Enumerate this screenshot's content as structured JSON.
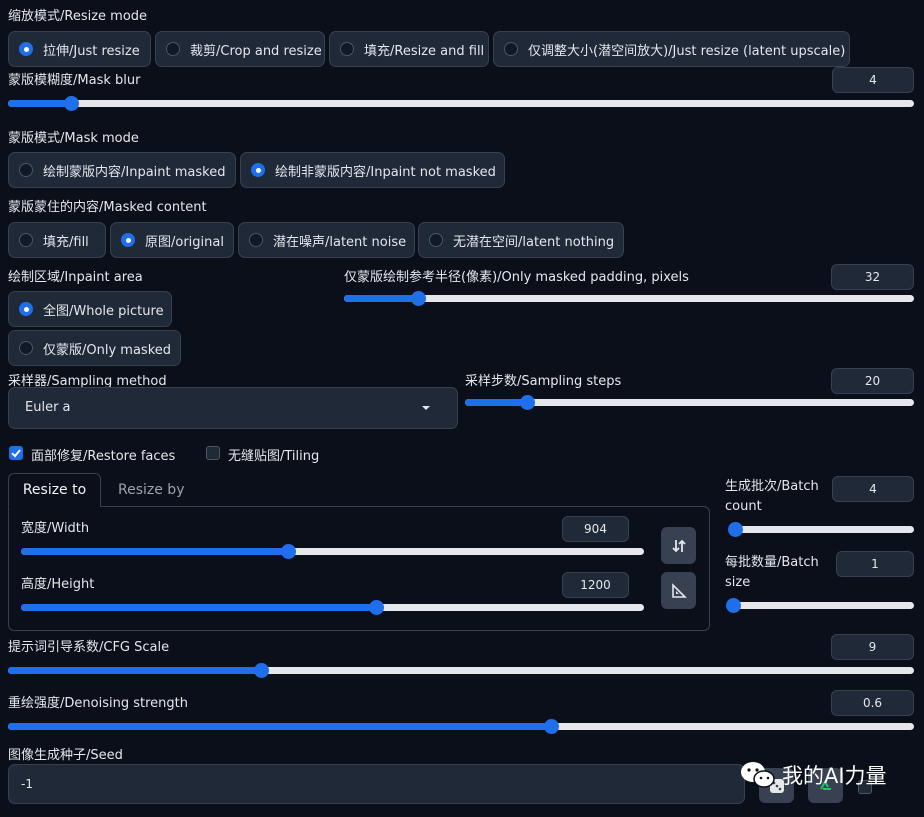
{
  "resize_mode": {
    "label": "缩放模式/Resize mode",
    "options": [
      "拉伸/Just resize",
      "裁剪/Crop and resize",
      "填充/Resize and fill",
      "仅调整大小(潜空间放大)/Just resize (latent upscale)"
    ],
    "selected": 0
  },
  "mask_blur": {
    "label": "蒙版模糊度/Mask blur",
    "value": "4",
    "fraction": 0.07
  },
  "mask_mode": {
    "label": "蒙版模式/Mask mode",
    "options": [
      "绘制蒙版内容/Inpaint masked",
      "绘制非蒙版内容/Inpaint not masked"
    ],
    "selected": 1
  },
  "masked_content": {
    "label": "蒙版蒙住的内容/Masked content",
    "options": [
      "填充/fill",
      "原图/original",
      "潜在噪声/latent noise",
      "无潜在空间/latent nothing"
    ],
    "selected": 1
  },
  "inpaint_area": {
    "label": "绘制区域/Inpaint area",
    "options": [
      "全图/Whole picture",
      "仅蒙版/Only masked"
    ],
    "selected": 0
  },
  "padding": {
    "label": "仅蒙版绘制参考半径(像素)/Only masked padding, pixels",
    "value": "32",
    "fraction": 0.13
  },
  "sampler": {
    "label": "采样器/Sampling method",
    "value": "Euler a"
  },
  "steps": {
    "label": "采样步数/Sampling steps",
    "value": "20",
    "fraction": 0.14
  },
  "restore_faces": {
    "label": "面部修复/Restore faces",
    "checked": true
  },
  "tiling": {
    "label": "无缝贴图/Tiling",
    "checked": false
  },
  "resize_tabs": [
    "Resize to",
    "Resize by"
  ],
  "width": {
    "label": "宽度/Width",
    "value": "904",
    "fraction": 0.43
  },
  "height": {
    "label": "高度/Height",
    "value": "1200",
    "fraction": 0.57
  },
  "batch_count": {
    "label_1": "生成批次/Batch",
    "label_2": "count",
    "value": "4",
    "fraction": 0.02
  },
  "batch_size": {
    "label_1": "每批数量/Batch",
    "label_2": "size",
    "value": "1",
    "fraction": 0.0
  },
  "cfg": {
    "label": "提示词引导系数/CFG Scale",
    "value": "9",
    "fraction": 0.28
  },
  "denoise": {
    "label": "重绘强度/Denoising strength",
    "value": "0.6",
    "fraction": 0.6
  },
  "seed": {
    "label": "图像生成种子/Seed",
    "value": "-1"
  },
  "watermark": "我的AI力量",
  "colors": {
    "accent": "#1f6feb",
    "background": "#0b0f19",
    "panel": "#1f2937",
    "border": "#374151"
  }
}
